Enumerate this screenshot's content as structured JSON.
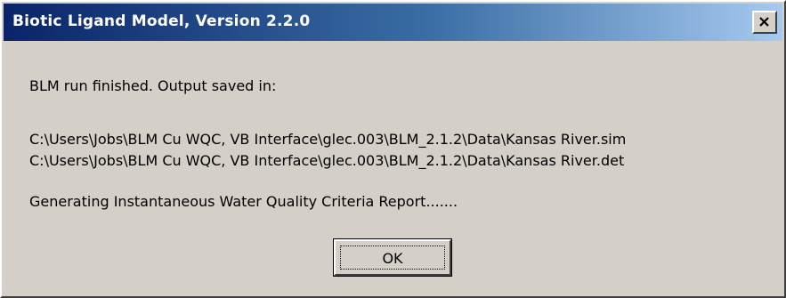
{
  "window": {
    "title": "Biotic Ligand Model, Version 2.2.0",
    "close_icon": "close-icon"
  },
  "message": {
    "line1": "BLM run finished. Output saved in:",
    "path1": "C:\\Users\\Jobs\\BLM Cu WQC, VB Interface\\glec.003\\BLM_2.1.2\\Data\\Kansas River.sim",
    "path2": "C:\\Users\\Jobs\\BLM Cu WQC, VB Interface\\glec.003\\BLM_2.1.2\\Data\\Kansas River.det",
    "status": "Generating Instantaneous Water Quality Criteria Report......."
  },
  "buttons": {
    "ok_label": "OK"
  },
  "colors": {
    "title_start": "#0a246a",
    "title_end": "#a6caf0",
    "face": "#d4d0c8"
  }
}
